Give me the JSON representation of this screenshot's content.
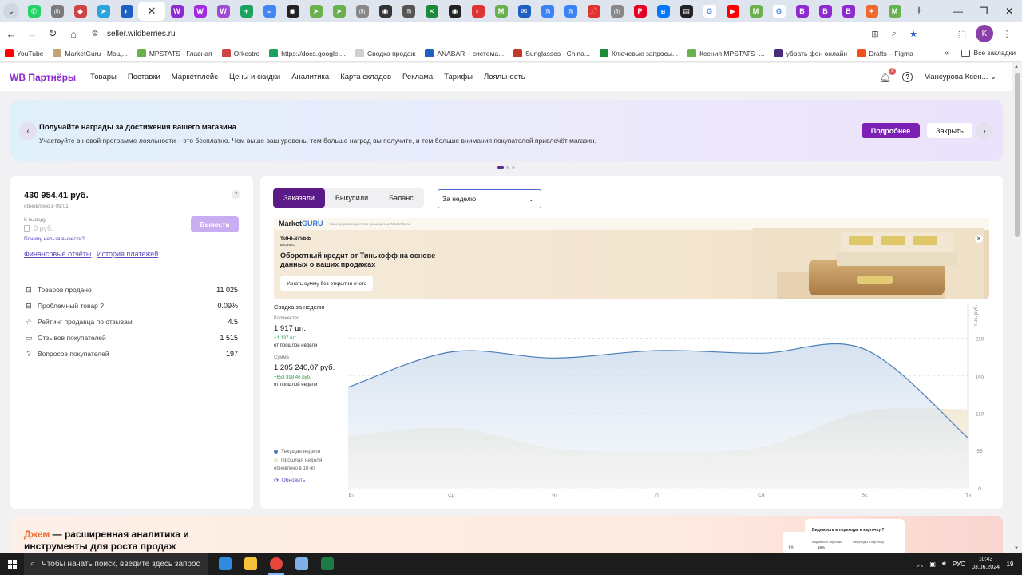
{
  "browser": {
    "tabs": [
      {
        "icon": "whatsapp-icon",
        "color": "#25d366",
        "glyph": "✆"
      },
      {
        "icon": "generic-icon",
        "color": "#7b7b7b",
        "glyph": "◎"
      },
      {
        "icon": "generic-icon",
        "color": "#c44",
        "glyph": "◆"
      },
      {
        "icon": "telegram-icon",
        "color": "#2aa3de",
        "glyph": "➤"
      },
      {
        "icon": "generic-icon",
        "color": "#1e5fbf",
        "glyph": "◐"
      },
      {
        "icon": "generic-icon",
        "color": "#8e2bd0",
        "glyph": "W"
      },
      {
        "icon": "generic-icon",
        "color": "#a12be0",
        "glyph": "W"
      },
      {
        "icon": "generic-icon",
        "color": "#a04ad8",
        "glyph": "W"
      },
      {
        "icon": "plus-icon",
        "color": "#1aa260",
        "glyph": "+"
      },
      {
        "icon": "docs-icon",
        "color": "#4285f4",
        "glyph": "≡"
      },
      {
        "icon": "generic-icon",
        "color": "#222",
        "glyph": "◉"
      },
      {
        "icon": "generic-icon",
        "color": "#6ab04c",
        "glyph": "➤"
      },
      {
        "icon": "generic-icon",
        "color": "#6ab04c",
        "glyph": "➤"
      },
      {
        "icon": "generic-icon",
        "color": "#888",
        "glyph": "◎"
      },
      {
        "icon": "generic-icon",
        "color": "#333",
        "glyph": "◉"
      },
      {
        "icon": "generic-icon",
        "color": "#555",
        "glyph": "◎"
      },
      {
        "icon": "generic-icon",
        "color": "#1b8a3a",
        "glyph": "✕"
      },
      {
        "icon": "generic-icon",
        "color": "#222",
        "glyph": "◉"
      },
      {
        "icon": "generic-icon",
        "color": "#d33",
        "glyph": "◐"
      },
      {
        "icon": "generic-icon",
        "color": "#6ab04c",
        "glyph": "M"
      },
      {
        "icon": "generic-icon",
        "color": "#1e5fbf",
        "glyph": "✉"
      },
      {
        "icon": "generic-icon",
        "color": "#3b82f6",
        "glyph": "◎"
      },
      {
        "icon": "generic-icon",
        "color": "#3b82f6",
        "glyph": "◎"
      },
      {
        "icon": "generic-icon",
        "color": "#d33",
        "glyph": "📌"
      },
      {
        "icon": "generic-icon",
        "color": "#888",
        "glyph": "◎"
      },
      {
        "icon": "pinterest-icon",
        "color": "#e60023",
        "glyph": "P"
      },
      {
        "icon": "vk-icon",
        "color": "#0077ff",
        "glyph": "в"
      },
      {
        "icon": "generic-icon",
        "color": "#222",
        "glyph": "▤"
      },
      {
        "icon": "google-icon",
        "color": "#fff",
        "glyph": "G"
      },
      {
        "icon": "youtube-icon",
        "color": "#ff0000",
        "glyph": "▶"
      },
      {
        "icon": "generic-icon",
        "color": "#6ab04c",
        "glyph": "M"
      },
      {
        "icon": "google-icon",
        "color": "#fff",
        "glyph": "G"
      },
      {
        "icon": "generic-icon",
        "color": "#8e2bd0",
        "glyph": "В"
      },
      {
        "icon": "generic-icon",
        "color": "#8e2bd0",
        "glyph": "В"
      },
      {
        "icon": "generic-icon",
        "color": "#8e2bd0",
        "glyph": "В"
      },
      {
        "icon": "generic-icon",
        "color": "#f06a2f",
        "glyph": "✦"
      },
      {
        "icon": "generic-icon",
        "color": "#6ab04c",
        "glyph": "M"
      }
    ],
    "active_tab_close": "✕",
    "new_tab": "+",
    "url": "seller.wildberries.ru"
  },
  "bookmarks": [
    {
      "label": "YouTube",
      "color": "#ff0000"
    },
    {
      "label": "MarketGuru - Мощ...",
      "color": "#c4a37a"
    },
    {
      "label": "MPSTATS - Главная",
      "color": "#6ab04c"
    },
    {
      "label": "Orkestro",
      "color": "#c44"
    },
    {
      "label": "https://docs.google....",
      "color": "#1aa260"
    },
    {
      "label": "Сводка продаж",
      "color": "#cfcfcf"
    },
    {
      "label": "ANABAR – система...",
      "color": "#1e5fbf"
    },
    {
      "label": "Sunglasses - China...",
      "color": "#c0392b"
    },
    {
      "label": "Ключевые запросы...",
      "color": "#1b8a3a"
    },
    {
      "label": "Ксения MPSTATS -...",
      "color": "#6ab04c"
    },
    {
      "label": "убрать фон онлайн",
      "color": "#4b2c7a"
    },
    {
      "label": "Drafts – Figma",
      "color": "#f24e1e"
    }
  ],
  "bookmarks_more": "»",
  "bookmarks_all": "Все закладки",
  "wb": {
    "logo": "WB Партнёры",
    "nav": [
      "Товары",
      "Поставки",
      "Маркетплейс",
      "Цены и скидки",
      "Аналитика",
      "Карта складов",
      "Реклама",
      "Тарифы",
      "Лояльность"
    ],
    "notif_count": "9",
    "user": "Мансурова Ксен..."
  },
  "banner": {
    "title": "Получайте награды за достижения вашего магазина",
    "text": "Участвуйте в новой программе лояльности – это бесплатно. Чем выше ваш уровень, тем больше наград вы получите, и тем больше внимания покупателей привлечёт магазин.",
    "more": "Подробнее",
    "close": "Закрыть"
  },
  "balance": {
    "amount": "430 954,41 руб.",
    "updated": "обновлено в 09:01",
    "withdraw_label": "К выводу",
    "withdraw_value": "0 руб.",
    "why": "Почему нельзя вывести?",
    "withdraw_btn": "Вывести",
    "link_reports": "Финансовые отчёты",
    "link_history": "История платежей",
    "stats": [
      {
        "icon": "box-icon",
        "glyph": "⊡",
        "label": "Товаров продано",
        "value": "11 025"
      },
      {
        "icon": "problem-box-icon",
        "glyph": "⊟",
        "label": "Проблемный товар ?",
        "value": "0.09%"
      },
      {
        "icon": "star-icon",
        "glyph": "☆",
        "label": "Рейтинг продавца по отзывам",
        "value": "4.5"
      },
      {
        "icon": "comment-icon",
        "glyph": "▭",
        "label": "Отзывов покупателей",
        "value": "1 515"
      },
      {
        "icon": "question-icon",
        "glyph": "?",
        "label": "Вопросов покупателей",
        "value": "197"
      }
    ]
  },
  "orders": {
    "tabs": [
      "Заказали",
      "Выкупили",
      "Баланс"
    ],
    "period": "За неделю",
    "ad": {
      "brand": "Market",
      "brand_accent": "GURU",
      "brand_note": "Баннер размещается в расширении MarketGuru",
      "bank": "ТИНЬКОФФ",
      "bank_sub": "БИЗНЕС",
      "title": "Оборотный кредит от Тинькофф на основе данных о ваших продажах",
      "button": "Узнать сумму без открытия счета"
    },
    "summary_title": "Сводка за неделю",
    "qty_label": "Количество",
    "qty_value": "1 917 шт.",
    "qty_delta": "+1 137 шт.",
    "qty_sub": "от прошлой недели",
    "sum_label": "Сумма",
    "sum_value": "1 205 240,07 руб.",
    "sum_delta": "+653 898,46 руб.",
    "sum_sub": "от прошлой недели",
    "legend_current": "Текущая неделя",
    "legend_prev": "Прошлая неделя",
    "legend_updated": "обновлено в 10:40",
    "refresh": "Обновить"
  },
  "chart_data": {
    "type": "area",
    "categories": [
      "Вт",
      "Ср",
      "Чт",
      "Пт",
      "Сб",
      "Вс",
      "Пн"
    ],
    "y_axis_label": "тыс. руб.",
    "y_ticks": [
      0,
      55,
      110,
      165,
      220
    ],
    "ylim": [
      0,
      270
    ],
    "series": [
      {
        "name": "Текущая неделя",
        "color": "#4a7db8",
        "values": [
          148,
          200,
          191,
          202,
          198,
          204,
          74
        ]
      },
      {
        "name": "Прошлая неделя",
        "color": "#efe3c8",
        "values": [
          75,
          88,
          57,
          52,
          59,
          112,
          115
        ]
      }
    ]
  },
  "promo": {
    "title_accent": "Джем",
    "title_rest": " — расширенная аналитика и",
    "title_line2": "инструменты для роста продаж",
    "card_title": "Видимость и переходы в карточку ?",
    "card_l1": "Видимость карточки",
    "card_l2": "Переходы в карточку",
    "card_v": "18%",
    "card2_v": "18"
  },
  "taskbar": {
    "search": "Чтобы начать поиск, введите здесь запрос",
    "apps": [
      {
        "name": "edge-icon",
        "color": "#2e8be0"
      },
      {
        "name": "explorer-icon",
        "color": "#f5c33b"
      },
      {
        "name": "chrome-icon",
        "color": "#e8453c"
      },
      {
        "name": "notepad-icon",
        "color": "#7fb0e8"
      },
      {
        "name": "excel-icon",
        "color": "#1d7a45"
      }
    ],
    "lang": "РУС",
    "time": "10:43",
    "date": "03.06.2024",
    "notif": "19"
  }
}
